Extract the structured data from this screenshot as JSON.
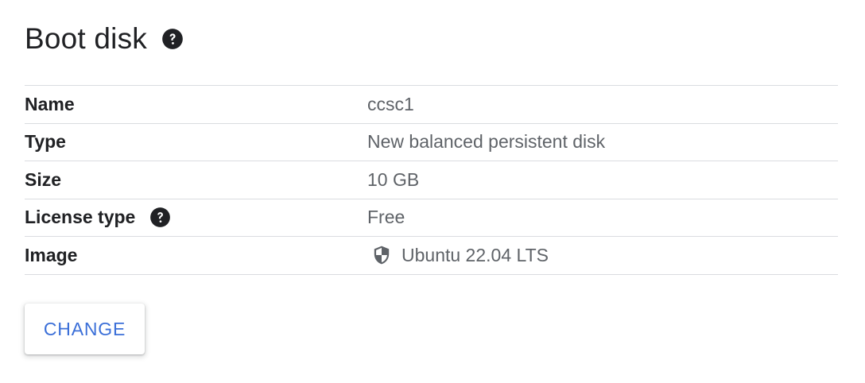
{
  "boot_disk": {
    "title": "Boot disk",
    "title_help_icon": "help-circle-icon",
    "rows": [
      {
        "label": "Name",
        "value": "ccsc1"
      },
      {
        "label": "Type",
        "value": "New balanced persistent disk"
      },
      {
        "label": "Size",
        "value": "10 GB"
      },
      {
        "label": "License type",
        "value": "Free",
        "label_icon": "help-circle-icon"
      },
      {
        "label": "Image",
        "value": "Ubuntu 22.04 LTS",
        "value_icon": "shield-icon"
      }
    ],
    "change_label": "CHANGE"
  },
  "colors": {
    "text_primary": "#202124",
    "text_secondary": "#5f6368",
    "divider": "#dadce0",
    "accent": "#3b6fd8",
    "icon": "#5f6368"
  }
}
